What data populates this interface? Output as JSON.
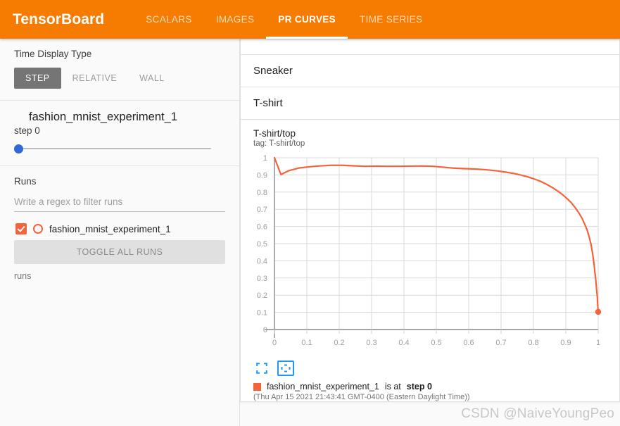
{
  "header": {
    "brand": "TensorBoard",
    "tabs": [
      {
        "label": "SCALARS",
        "active": false
      },
      {
        "label": "IMAGES",
        "active": false
      },
      {
        "label": "PR CURVES",
        "active": true
      },
      {
        "label": "TIME SERIES",
        "active": false
      }
    ],
    "accent_color": "#f57c00"
  },
  "sidebar": {
    "time_display": {
      "label": "Time Display Type",
      "options": [
        "STEP",
        "RELATIVE",
        "WALL"
      ],
      "selected": "STEP"
    },
    "run_slider": {
      "run_name": "fashion_mnist_experiment_1",
      "run_color": "#f4633a",
      "step_label": "step 0",
      "slider_value": 0,
      "slider_min": 0,
      "slider_max": 100
    },
    "runs": {
      "label": "Runs",
      "filter_placeholder": "Write a regex to filter runs",
      "filter_value": "",
      "items": [
        {
          "name": "fashion_mnist_experiment_1",
          "checked": true,
          "color": "#f4633a"
        }
      ],
      "toggle_all_label": "TOGGLE ALL RUNS",
      "footer": "runs"
    }
  },
  "main": {
    "categories": [
      {
        "label": "Sneaker"
      },
      {
        "label": "T-shirt"
      }
    ],
    "chart_card": {
      "title": "T-shirt/top",
      "tag": "tag: T-shirt/top",
      "tools": [
        {
          "icon": "expand-icon",
          "active": false
        },
        {
          "icon": "fit-domain-icon",
          "active": true
        }
      ],
      "legend": {
        "run_name": "fashion_mnist_experiment_1",
        "is_at": "is at",
        "step": "step 0",
        "timestamp": "(Thu Apr 15 2021 21:43:41 GMT-0400 (Eastern Daylight Time))",
        "color": "#f4633a"
      }
    }
  },
  "watermark": "CSDN @NaiveYoungPeo",
  "chart_data": {
    "type": "line",
    "title": "T-shirt/top",
    "subtitle": "tag: T-shirt/top",
    "xlabel": "",
    "ylabel": "",
    "xlim": [
      0,
      1
    ],
    "ylim": [
      0,
      1
    ],
    "xticks": [
      0,
      0.1,
      0.2,
      0.3,
      0.4,
      0.5,
      0.6,
      0.7,
      0.8,
      0.9,
      1
    ],
    "yticks": [
      0,
      0.1,
      0.2,
      0.3,
      0.4,
      0.5,
      0.6,
      0.7,
      0.8,
      0.9,
      1
    ],
    "xticklabels": [
      "0",
      "0.1",
      "0.2",
      "0.3",
      "0.4",
      "0.5",
      "0.6",
      "0.7",
      "0.8",
      "0.9",
      "1"
    ],
    "yticklabels": [
      "0",
      "0.1",
      "0.2",
      "0.3",
      "0.4",
      "0.5",
      "0.6",
      "0.7",
      "0.8",
      "0.9",
      "1"
    ],
    "grid": true,
    "legend_position": "below",
    "series": [
      {
        "name": "fashion_mnist_experiment_1",
        "color": "#f4633a",
        "x": [
          0.0,
          0.02,
          0.045,
          0.075,
          0.105,
          0.14,
          0.175,
          0.21,
          0.245,
          0.28,
          0.315,
          0.35,
          0.385,
          0.42,
          0.455,
          0.49,
          0.52,
          0.55,
          0.58,
          0.61,
          0.64,
          0.665,
          0.69,
          0.715,
          0.74,
          0.76,
          0.78,
          0.8,
          0.82,
          0.838,
          0.855,
          0.872,
          0.888,
          0.902,
          0.916,
          0.928,
          0.94,
          0.95,
          0.958,
          0.966,
          0.972,
          0.978,
          0.983,
          0.987,
          0.99,
          0.993,
          0.995,
          0.997,
          0.998,
          0.999,
          1.0
        ],
        "y": [
          1.0,
          0.902,
          0.925,
          0.94,
          0.947,
          0.952,
          0.956,
          0.956,
          0.953,
          0.95,
          0.951,
          0.95,
          0.95,
          0.951,
          0.952,
          0.95,
          0.945,
          0.94,
          0.937,
          0.935,
          0.932,
          0.928,
          0.923,
          0.916,
          0.908,
          0.9,
          0.89,
          0.878,
          0.864,
          0.848,
          0.83,
          0.81,
          0.788,
          0.765,
          0.74,
          0.712,
          0.68,
          0.648,
          0.615,
          0.578,
          0.54,
          0.495,
          0.44,
          0.385,
          0.33,
          0.28,
          0.235,
          0.195,
          0.16,
          0.13,
          0.103
        ],
        "endpoint": {
          "x": 1.0,
          "y": 0.103
        }
      }
    ]
  }
}
